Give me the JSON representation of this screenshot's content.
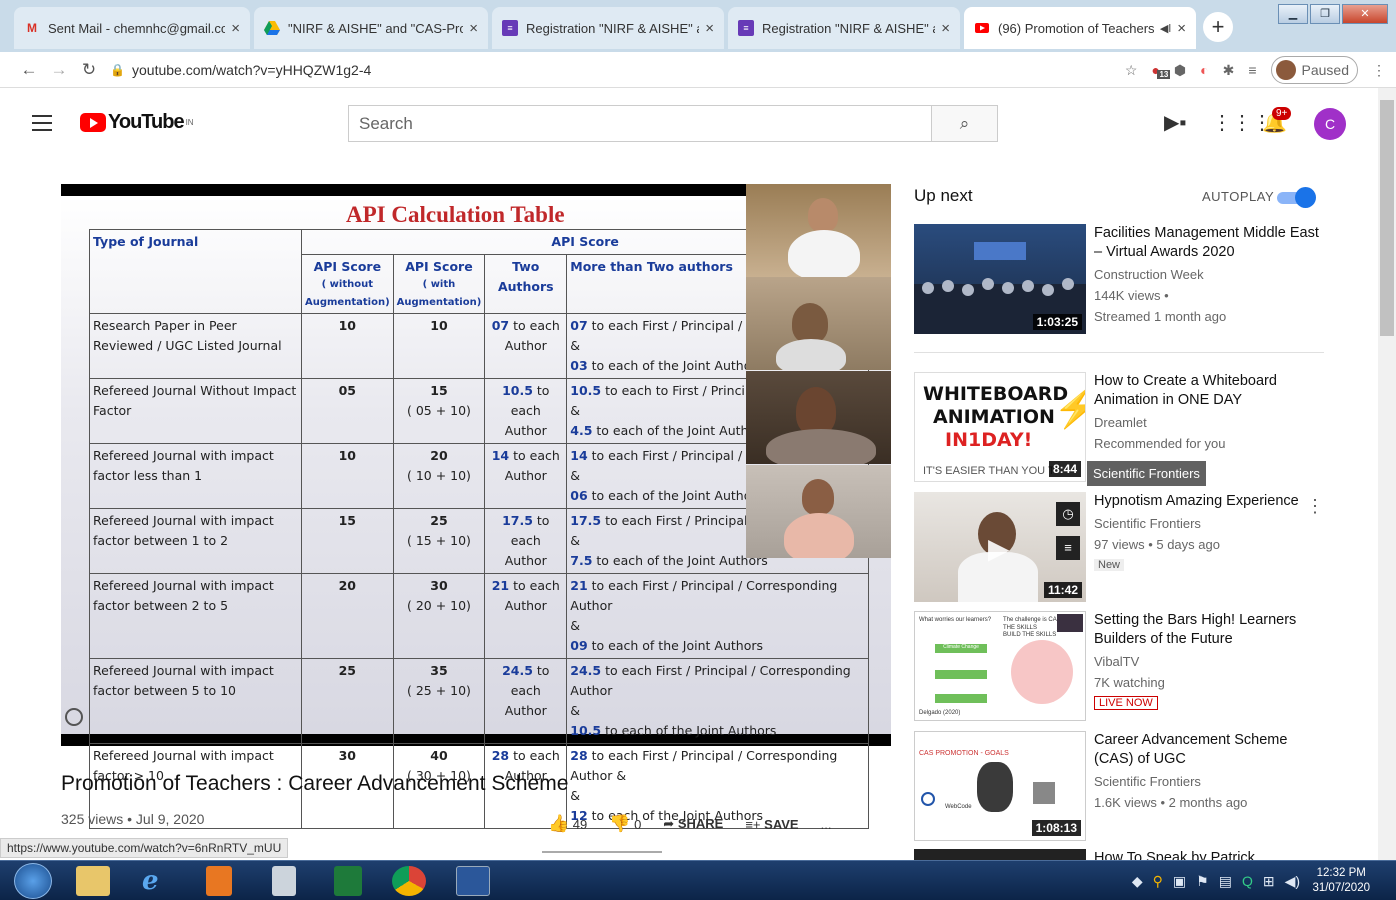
{
  "browser": {
    "tabs": [
      {
        "icon": "gmail-icon",
        "title": "Sent Mail - chemnhc@gmail.co"
      },
      {
        "icon": "google-drive-icon",
        "title": "\"NIRF & AISHE\" and \"CAS-Prom"
      },
      {
        "icon": "google-forms-icon",
        "title": "Registration \"NIRF & AISHE\" an"
      },
      {
        "icon": "google-forms-icon",
        "title": "Registration \"NIRF & AISHE\" an"
      },
      {
        "icon": "youtube-icon",
        "title": "(96) Promotion of Teachers"
      }
    ],
    "url": "youtube.com/watch?v=yHHQZW1g2-4",
    "profile_status": "Paused",
    "ext_badge": "13"
  },
  "youtube": {
    "logo_text": "YouTube",
    "region": "IN",
    "search_placeholder": "Search",
    "notification_count": "9+",
    "avatar_letter": "C"
  },
  "slide": {
    "title": "API Calculation Table",
    "headers": {
      "type": "Type of Journal",
      "api_score": "API Score",
      "col1": "API Score",
      "col1_sub": "( without Augmentation)",
      "col2": "API Score",
      "col2_sub": "( with Augmentation)",
      "col3": "Two Authors",
      "col4": "More than Two authors"
    },
    "rows": [
      {
        "type": "Research Paper in Peer Reviewed / UGC Listed Journal",
        "a": "10",
        "b": "10",
        "b2": "",
        "two": "07",
        "two_rest": " to each Author",
        "more1": "07",
        "more1_rest": " to each First / Principal / Corres",
        "more2": "03",
        "more2_rest": " to each of the Joint Authors"
      },
      {
        "type": "Refereed Journal Without Impact Factor",
        "a": "05",
        "b": "15",
        "b2": "( 05 + 10)",
        "two": "10.5",
        "two_rest": " to each Author",
        "more1": "10.5",
        "more1_rest": " to each to First / Principal / C Author",
        "more2": "4.5",
        "more2_rest": " to each of the Joint Authors"
      },
      {
        "type": "Refereed Journal with impact factor less than 1",
        "a": "10",
        "b": "20",
        "b2": "( 10 + 10)",
        "two": "14",
        "two_rest": " to each Author",
        "more1": "14",
        "more1_rest": " to each First / Principal / Corres",
        "more2": "06",
        "more2_rest": " to each of the Joint Authors"
      },
      {
        "type": "Refereed Journal with impact factor between 1 to 2",
        "a": "15",
        "b": "25",
        "b2": "( 15 + 10)",
        "two": "17.5",
        "two_rest": " to each Author",
        "more1": "17.5",
        "more1_rest": " to each First / Principal / Corr",
        "more2": "7.5",
        "more2_rest": " to each of the Joint Authors"
      },
      {
        "type": "Refereed Journal with impact factor between 2 to 5",
        "a": "20",
        "b": "30",
        "b2": "( 20 + 10)",
        "two": "21",
        "two_rest": " to each Author",
        "more1": "21",
        "more1_rest": " to each First / Principal / Corresponding Author",
        "more2": "09",
        "more2_rest": " to each of the Joint Authors"
      },
      {
        "type": "Refereed Journal with impact factor between 5 to 10",
        "a": "25",
        "b": "35",
        "b2": "( 25 + 10)",
        "two": "24.5",
        "two_rest": " to each Author",
        "more1": "24.5",
        "more1_rest": " to each First / Principal / Corresponding Author",
        "more2": "10.5",
        "more2_rest": " to each of the Joint Authors"
      },
      {
        "type": "Refereed Journal with impact factor > 10",
        "a": "30",
        "b": "40",
        "b2": "( 30 + 10)",
        "two": "28",
        "two_rest": " to each Author",
        "more1": "28",
        "more1_rest": " to each First / Principal / Corresponding Author &",
        "more2": "12",
        "more2_rest": " to each of the Joint Authors"
      }
    ],
    "amp": "&"
  },
  "video": {
    "title": "Promotion of Teachers : Career Advancement Scheme",
    "meta": "325 views • Jul 9, 2020",
    "likes": "49",
    "dislikes": "0",
    "share": "SHARE",
    "save": "SAVE",
    "more": "..."
  },
  "status_url": "https://www.youtube.com/watch?v=6nRnRTV_mUU",
  "sidebar": {
    "up_next": "Up next",
    "autoplay": "AUTOPLAY",
    "autoplay_on": true,
    "tooltip": "Scientific Frontiers",
    "recs": [
      {
        "title": "Facilities Management Middle East – Virtual Awards 2020",
        "channel": "Construction Week",
        "meta1": "144K views •",
        "meta2": "Streamed 1 month ago",
        "duration": "1:03:25",
        "thumb": "awards"
      },
      {
        "title": "How to Create a Whiteboard Animation in ONE DAY",
        "channel": "Dreamlet",
        "meta1": "Recommended for you",
        "meta2": "",
        "duration": "8:44",
        "thumb": "whiteboard",
        "thumb_text": [
          "WHITEBOARD",
          "ANIMATION",
          "IN1DAY!",
          "IT'S EASIER THAN YOU T"
        ]
      },
      {
        "title": "Hypnotism Amazing Experience",
        "channel": "Scientific Frontiers",
        "meta1": "97 views • 5 days ago",
        "meta2": "",
        "badge": "New",
        "duration": "11:42",
        "thumb": "speaker"
      },
      {
        "title": "Setting the Bars High! Learners Builders of the Future",
        "channel": "VibalTV",
        "meta1": "7K watching",
        "meta2": "",
        "live": "LIVE NOW",
        "duration": "",
        "thumb": "slides",
        "thumb_text": [
          "What worries our learners?",
          "The challenge is CAS THE SKILLS",
          "BUILD THE SKILLS",
          "Climate Change",
          "Delgado (2020)"
        ]
      },
      {
        "title": "Career Advancement Scheme (CAS) of UGC",
        "channel": "Scientific Frontiers",
        "meta1": "1.6K views • 2 months ago",
        "meta2": "",
        "duration": "1:08:13",
        "thumb": "cas",
        "thumb_text": [
          "CAS PROMOTION - GOALS",
          "WebCode"
        ]
      },
      {
        "title": "How To Speak by Patrick",
        "channel": "",
        "meta1": "",
        "meta2": "",
        "duration": "",
        "thumb": "dark"
      }
    ]
  },
  "clock": {
    "time": "12:32 PM",
    "date": "31/07/2020"
  }
}
